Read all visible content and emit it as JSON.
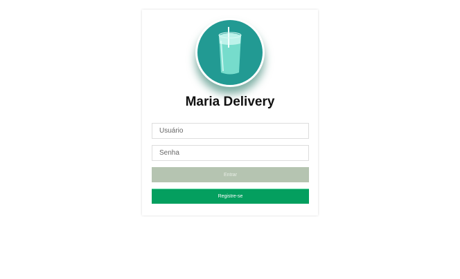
{
  "app": {
    "title": "Maria Delivery",
    "logo_icon": "juice-glass-icon",
    "accent": "#229a93"
  },
  "form": {
    "username_placeholder": "Usuário",
    "password_placeholder": "Senha",
    "login_label": "Entrar",
    "register_label": "Registre-se",
    "login_color": "#b5c4b1",
    "register_color": "#049f5f"
  }
}
